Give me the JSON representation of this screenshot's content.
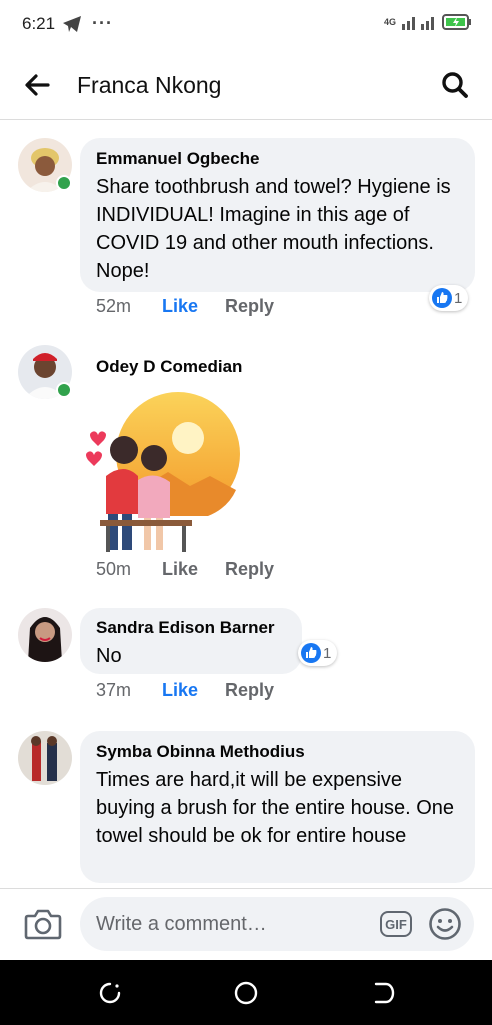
{
  "status_bar": {
    "time": "6:21",
    "network": "4G",
    "more": "···"
  },
  "header": {
    "title": "Franca Nkong",
    "back_icon": "arrow-left-icon",
    "search_icon": "search-icon"
  },
  "comments": [
    {
      "author": "Emmanuel Ogbeche",
      "text": "Share toothbrush and towel? Hygiene is INDIVIDUAL! Imagine in this age of COVID 19 and other mouth infections. Nope!",
      "time": "52m",
      "like_label": "Like",
      "like_active": true,
      "reply_label": "Reply",
      "reaction_count": "1",
      "online": true
    },
    {
      "author": "Odey D Comedian",
      "sticker": "couple-sunset-sticker",
      "time": "50m",
      "like_label": "Like",
      "like_active": false,
      "reply_label": "Reply",
      "online": true
    },
    {
      "author": "Sandra Edison Barner",
      "text": "No",
      "time": "37m",
      "like_label": "Like",
      "like_active": true,
      "reply_label": "Reply",
      "reaction_count": "1",
      "online": false
    },
    {
      "author": "Symba Obinna Methodius",
      "text": "Times are hard,it will be expensive buying a brush for the entire house. One towel should be ok for entire house",
      "online": false
    }
  ],
  "composer": {
    "placeholder": "Write a comment…",
    "gif_label": "GIF"
  },
  "colors": {
    "accent": "#1877f2",
    "bubble": "#f0f2f5",
    "online": "#31a24c"
  }
}
